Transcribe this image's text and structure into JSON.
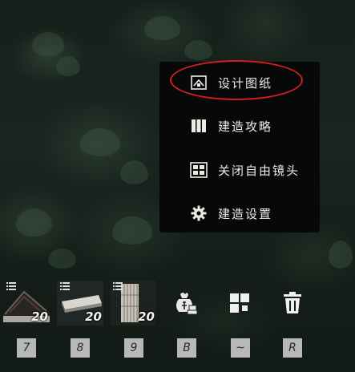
{
  "menu": {
    "items": [
      {
        "label": "设计图纸",
        "icon": "blueprint-icon",
        "highlighted": true
      },
      {
        "label": "建造攻略",
        "icon": "guide-book-icon",
        "highlighted": false
      },
      {
        "label": "关闭自由镜头",
        "icon": "free-camera-icon",
        "highlighted": false
      },
      {
        "label": "建造设置",
        "icon": "gear-icon",
        "highlighted": false
      }
    ],
    "highlight_color": "#d01e22"
  },
  "toolbar": {
    "slots": [
      {
        "icon": "roof-piece-icon",
        "count": "20",
        "key": "7"
      },
      {
        "icon": "floor-piece-icon",
        "count": "20",
        "key": "8"
      },
      {
        "icon": "wall-piece-icon",
        "count": "20",
        "key": "9"
      }
    ],
    "buttons": [
      {
        "icon": "materials-sack-icon",
        "key": "B"
      },
      {
        "icon": "grid-tiles-icon",
        "key": "~"
      },
      {
        "icon": "trash-can-icon",
        "key": "R"
      }
    ]
  }
}
